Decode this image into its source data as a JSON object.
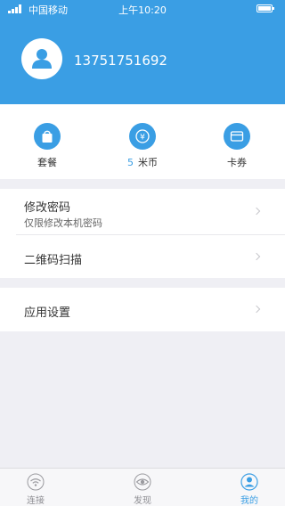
{
  "status_bar": {
    "carrier": "中国移动",
    "time": "上午10:20"
  },
  "profile": {
    "phone": "13751751692"
  },
  "quick_actions": [
    {
      "icon": "bag-icon",
      "label": "套餐"
    },
    {
      "icon": "yuan-coin-icon",
      "count": "5",
      "label": "米币"
    },
    {
      "icon": "card-icon",
      "label": "卡券"
    }
  ],
  "menu": {
    "change_password": {
      "title": "修改密码",
      "subtitle": "仅限修改本机密码"
    },
    "qr_scan": {
      "title": "二维码扫描"
    },
    "app_settings": {
      "title": "应用设置"
    }
  },
  "tabbar": [
    {
      "icon": "wifi-icon",
      "label": "连接"
    },
    {
      "icon": "eye-icon",
      "label": "发现"
    },
    {
      "icon": "user-icon",
      "label": "我的",
      "active": true
    }
  ],
  "colors": {
    "accent": "#3a9ee4",
    "background": "#efeff4"
  }
}
